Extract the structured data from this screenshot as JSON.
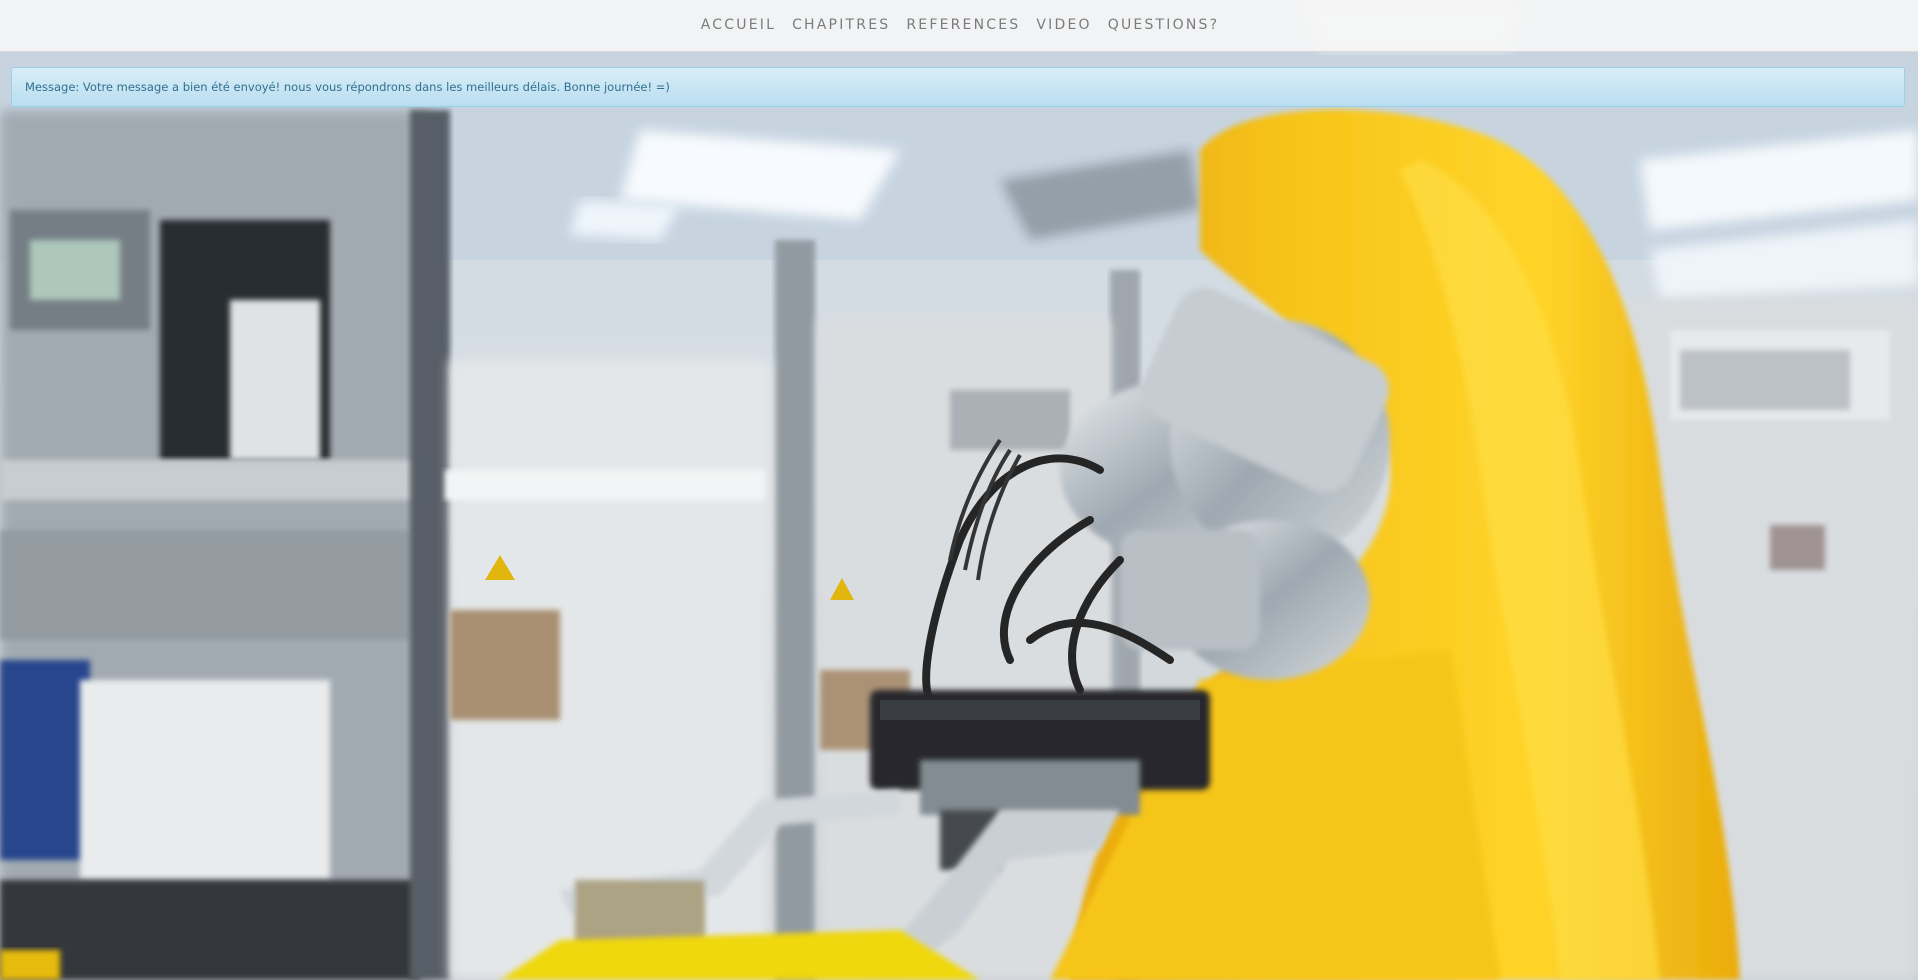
{
  "navbar": {
    "items": [
      {
        "label": "ACCUEIL"
      },
      {
        "label": "CHAPITRES"
      },
      {
        "label": "REFERENCES"
      },
      {
        "label": "VIDEO"
      },
      {
        "label": "QUESTIONS?"
      }
    ]
  },
  "alert": {
    "text": "Message: Votre message a bien été envoyé! nous vous répondrons dans les meilleurs délais. Bonne journée! =)"
  },
  "hero": {
    "image_description_icon": "robot-arm-lab-photo",
    "accent_color": "#f2b705"
  }
}
